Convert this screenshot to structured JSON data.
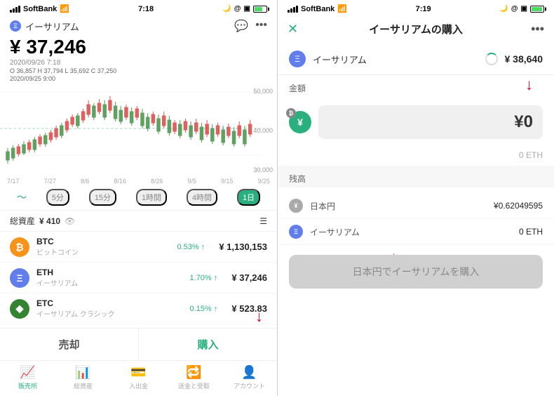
{
  "screen1": {
    "statusBar": {
      "carrier": "SoftBank",
      "wifi": "wifi",
      "time": "7:18",
      "battery": "80"
    },
    "header": {
      "coinLabel": "イーサリアム"
    },
    "price": {
      "value": "¥ 37,246",
      "datetime": "2020/09/26 7:18",
      "ohlc": "O 36,857  H 37,794  L 35,692  C 37,250",
      "prevDate": "2020/09/25 9:00"
    },
    "chartLabels": {
      "y": [
        "50,000",
        "40,000",
        "30,000"
      ],
      "x": [
        "7/17",
        "7/27",
        "8/6",
        "8/16",
        "8/26",
        "9/5",
        "9/15",
        "9/25"
      ]
    },
    "timeButtons": [
      "5分",
      "15分",
      "1時間",
      "4時間",
      "1日"
    ],
    "activeTime": "1日",
    "assets": {
      "label": "総資産",
      "value": "¥ 410",
      "coins": [
        {
          "symbol": "BTC",
          "name": "ビットコイン",
          "change": "0.53% ↑",
          "price": "¥ 1,130,153"
        },
        {
          "symbol": "ETH",
          "name": "イーサリアム",
          "change": "1.70% ↑",
          "price": "¥ 37,246"
        },
        {
          "symbol": "ETC",
          "name": "イーサリアム クラシック",
          "change": "0.15% ↑",
          "price": "¥ 523.83"
        }
      ]
    },
    "actions": {
      "sell": "売却",
      "buy": "購入"
    },
    "bottomNav": [
      {
        "label": "販売所",
        "icon": "📈",
        "active": true
      },
      {
        "label": "総資産",
        "icon": "📊"
      },
      {
        "label": "入出金",
        "icon": "💳"
      },
      {
        "label": "送金と受取",
        "icon": "🔁"
      },
      {
        "label": "アカウント",
        "icon": "👤"
      }
    ]
  },
  "screen2": {
    "statusBar": {
      "carrier": "SoftBank",
      "wifi": "wifi",
      "time": "7:19",
      "battery": "full"
    },
    "header": {
      "title": "イーサリアムの購入",
      "closeLabel": "✕",
      "moreLabel": "•••"
    },
    "coinInfo": {
      "icon": "Ξ",
      "name": "イーサリアム",
      "price": "¥ 38,640"
    },
    "amountSection": {
      "label": "金額",
      "value": "¥0",
      "ethAmount": "0 ETH"
    },
    "balanceSection": {
      "label": "残高",
      "items": [
        {
          "currency": "日本円",
          "type": "jpy",
          "icon": "¥",
          "amount": "¥0.62049595"
        },
        {
          "currency": "イーサリアム",
          "type": "eth",
          "icon": "Ξ",
          "amount": "0 ETH"
        }
      ]
    },
    "buyButton": "日本円でイーサリアムを購入"
  }
}
